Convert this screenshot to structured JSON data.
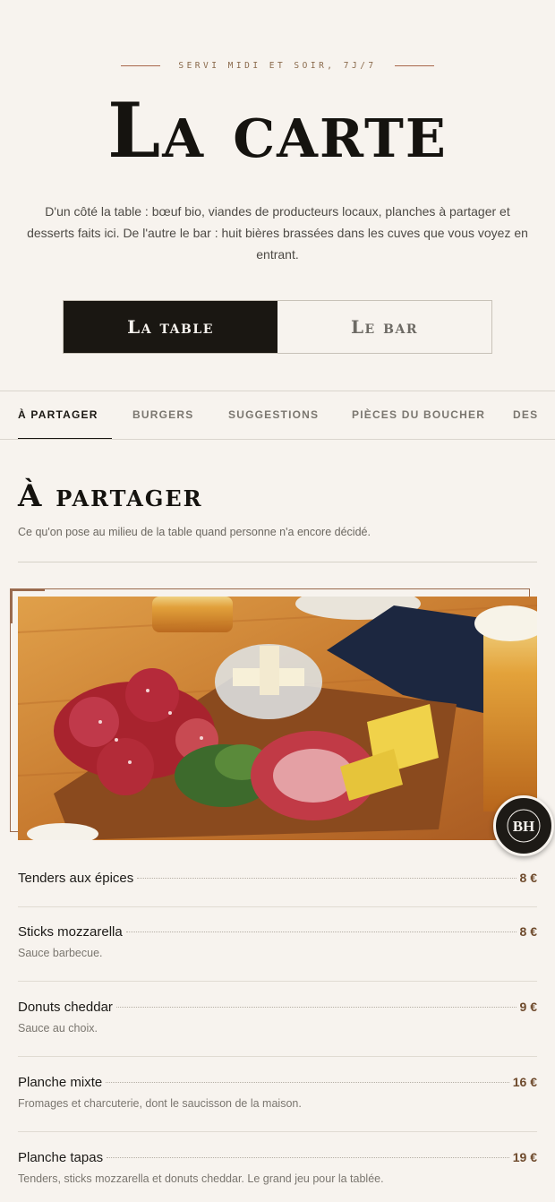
{
  "header": {
    "kicker": "SERVI MIDI ET SOIR, 7J/7",
    "title": "La carte",
    "intro": "D'un côté la table : bœuf bio, viandes de producteurs locaux, planches à partager et desserts faits ici. De l'autre le bar : huit bières brassées dans les cuves que vous voyez en entrant."
  },
  "switch": {
    "options": [
      {
        "label": "La table",
        "active": true
      },
      {
        "label": "Le bar",
        "active": false
      }
    ]
  },
  "tabs": [
    {
      "label": "À PARTAGER",
      "active": true
    },
    {
      "label": "BURGERS",
      "active": false
    },
    {
      "label": "SUGGESTIONS",
      "active": false
    },
    {
      "label": "PIÈCES DU BOUCHER",
      "active": false
    },
    {
      "label": "DES",
      "active": false
    }
  ],
  "section": {
    "title": "À partager",
    "subtitle": "Ce qu'on pose au milieu de la table quand personne n'a encore décidé."
  },
  "logo": {
    "text": "BH"
  },
  "items": [
    {
      "name": "Tenders aux épices",
      "price": "8 €",
      "desc": ""
    },
    {
      "name": "Sticks mozzarella",
      "price": "8 €",
      "desc": "Sauce barbecue."
    },
    {
      "name": "Donuts cheddar",
      "price": "9 €",
      "desc": "Sauce au choix."
    },
    {
      "name": "Planche mixte",
      "price": "16 €",
      "desc": "Fromages et charcuterie, dont le saucisson de la maison."
    },
    {
      "name": "Planche tapas",
      "price": "19 €",
      "desc": "Tenders, sticks mozzarella et donuts cheddar. Le grand jeu pour la tablée."
    }
  ],
  "colors": {
    "accent": "#9a6a4e",
    "dark": "#1a1712",
    "background": "#f7f3ee",
    "price": "#6e4a2c"
  }
}
